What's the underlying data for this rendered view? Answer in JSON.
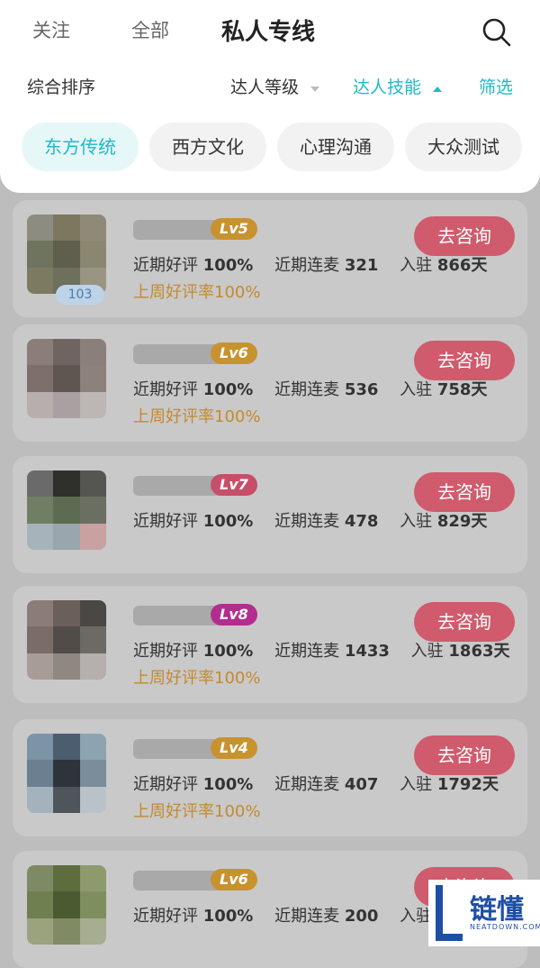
{
  "header": {
    "tabs": [
      "关注",
      "全部",
      "私人专线"
    ],
    "active_tab": "私人专线",
    "search_icon": "search-icon"
  },
  "sort": {
    "items": [
      "综合排序",
      "达人等级",
      "达人技能",
      "筛选"
    ]
  },
  "chips": [
    "东方传统",
    "西方文化",
    "心理沟通",
    "大众测试"
  ],
  "cards": [
    {
      "level": "Lv5",
      "level_color": "#c8922f",
      "button": "去咨询",
      "stats": {
        "praise_label": "近期好评",
        "praise_value": "100%",
        "mic_label": "近期连麦",
        "mic_value": "321",
        "join_label": "入驻",
        "join_value": "866天"
      },
      "highlight": "上周好评率100%",
      "badge": "103"
    },
    {
      "level": "Lv6",
      "level_color": "#c8922f",
      "button": "去咨询",
      "stats": {
        "praise_label": "近期好评",
        "praise_value": "100%",
        "mic_label": "近期连麦",
        "mic_value": "536",
        "join_label": "入驻",
        "join_value": "758天"
      },
      "highlight": "上周好评率100%"
    },
    {
      "level": "Lv7",
      "level_color": "#c74e69",
      "button": "去咨询",
      "stats": {
        "praise_label": "近期好评",
        "praise_value": "100%",
        "mic_label": "近期连麦",
        "mic_value": "478",
        "join_label": "入驻",
        "join_value": "829天"
      }
    },
    {
      "level": "Lv8",
      "level_color": "#b22d8e",
      "button": "去咨询",
      "stats": {
        "praise_label": "近期好评",
        "praise_value": "100%",
        "mic_label": "近期连麦",
        "mic_value": "1433",
        "join_label": "入驻",
        "join_value": "1863天"
      },
      "highlight": "上周好评率100%"
    },
    {
      "level": "Lv4",
      "level_color": "#c8922f",
      "button": "去咨询",
      "stats": {
        "praise_label": "近期好评",
        "praise_value": "100%",
        "mic_label": "近期连麦",
        "mic_value": "407",
        "join_label": "入驻",
        "join_value": "1792天"
      },
      "highlight": "上周好评率100%"
    },
    {
      "level": "Lv6",
      "level_color": "#c8922f",
      "button": "去咨询",
      "stats": {
        "praise_label": "近期好评",
        "praise_value": "100%",
        "mic_label": "近期连麦",
        "mic_value": "200",
        "join_label": "入驻",
        "join_value": ""
      }
    }
  ],
  "watermark": {
    "title": "链懂",
    "subtitle": "NEATDOWN.COM"
  },
  "colors": {
    "accent": "#20b9c9",
    "consult_button": "#cf5b6c",
    "highlight_text": "#c48a2e",
    "overlay_bg": "#bdbdbd"
  }
}
